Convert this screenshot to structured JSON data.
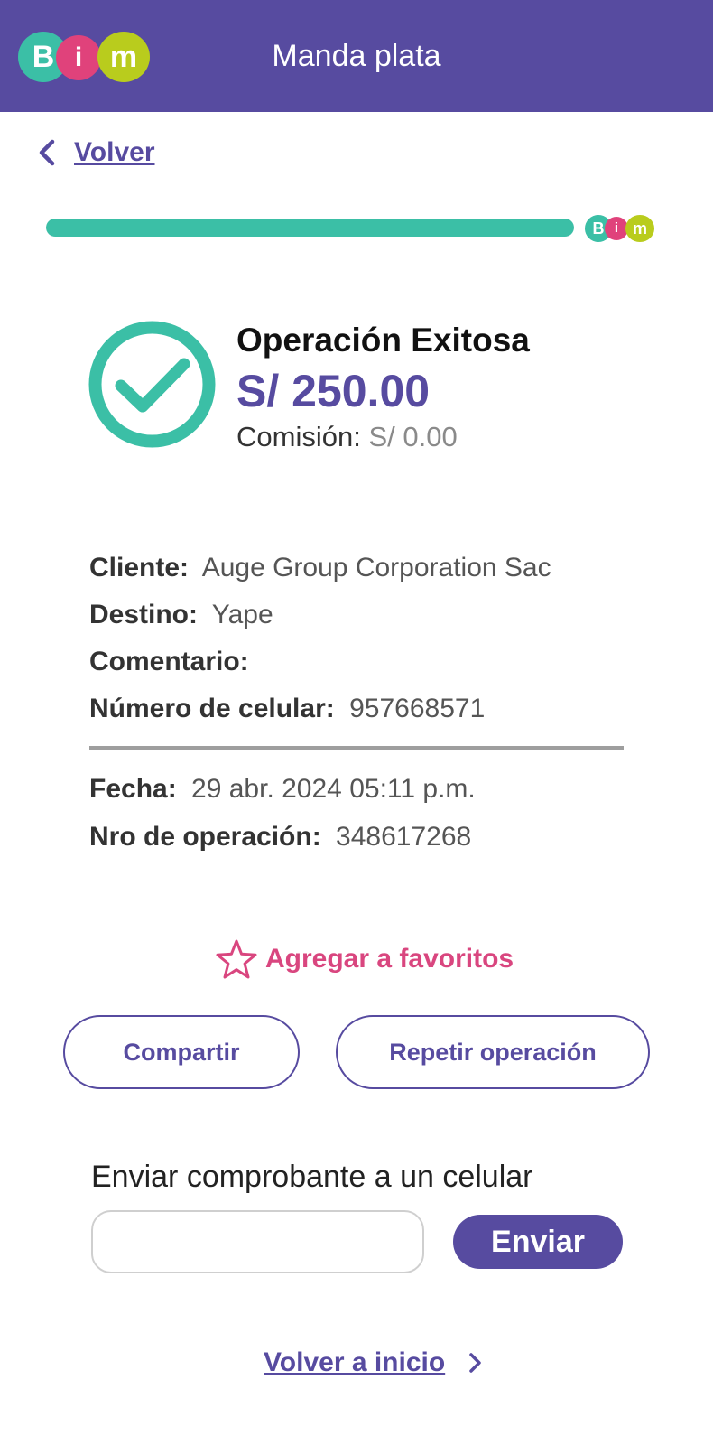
{
  "header": {
    "logo_letters": [
      "B",
      "i",
      "m"
    ],
    "title": "Manda plata"
  },
  "nav": {
    "back_label": "Volver"
  },
  "progress": {
    "fraction": 1.0
  },
  "result": {
    "title": "Operación Exitosa",
    "amount": "S/ 250.00",
    "fee_label": "Comisión:",
    "fee_value": "S/ 0.00"
  },
  "details": [
    {
      "label": "Cliente:",
      "value": "Auge Group Corporation Sac"
    },
    {
      "label": "Destino:",
      "value": "Yape"
    },
    {
      "label": "Comentario:",
      "value": ""
    },
    {
      "label": "Número de celular:",
      "value": "957668571"
    }
  ],
  "meta": [
    {
      "label": "Fecha:",
      "value": "29 abr. 2024 05:11 p.m."
    },
    {
      "label": "Nro de operación:",
      "value": "348617268"
    }
  ],
  "favorites": {
    "label": "Agregar a favoritos"
  },
  "actions": {
    "share_label": "Compartir",
    "repeat_label": "Repetir operación"
  },
  "send_receipt": {
    "label": "Enviar comprobante a un celular",
    "input_value": "",
    "button_label": "Enviar"
  },
  "footer": {
    "home_label": "Volver a inicio"
  },
  "colors": {
    "primary": "#574ba0",
    "success": "#3bbfa6",
    "accent_pink": "#d9467f",
    "logo_teal": "#3bbfa6",
    "logo_pink": "#e0427b",
    "logo_lime": "#b9cc1d"
  },
  "icons": {
    "back": "chevron-left-icon",
    "success": "check-circle-icon",
    "favorite": "star-outline-icon",
    "home": "chevron-right-icon"
  }
}
